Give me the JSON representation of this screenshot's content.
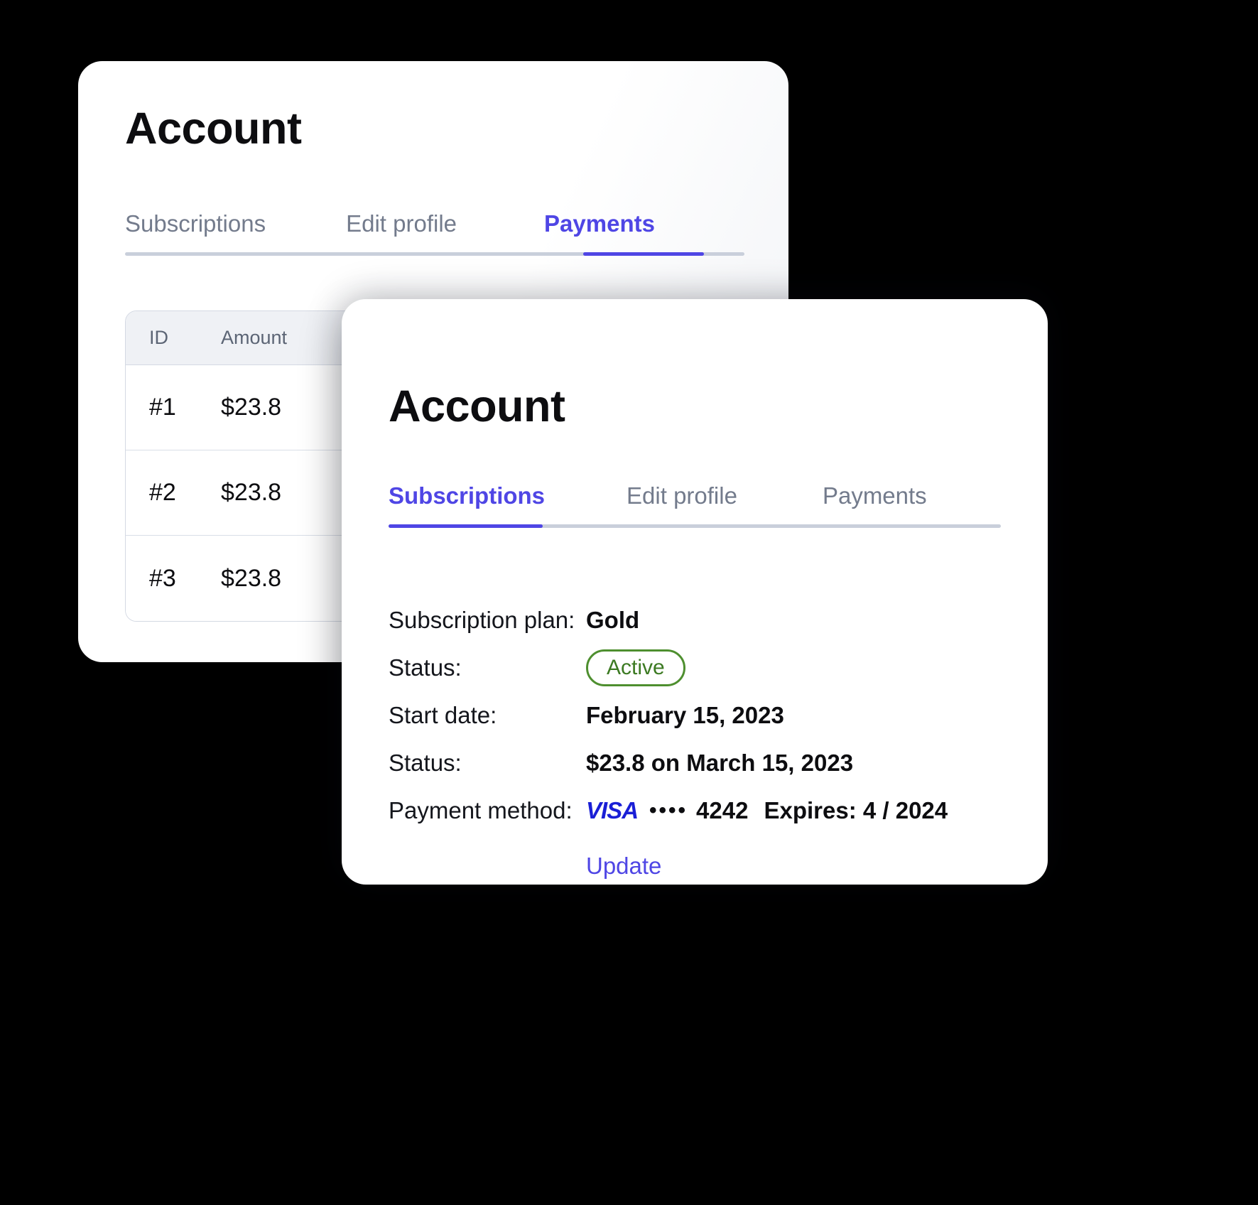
{
  "accent": "#4f46e5",
  "status_green": "#4e8f2f",
  "visa_blue": "#1a1fd6",
  "back_card": {
    "title": "Account",
    "tabs": [
      {
        "label": "Subscriptions",
        "active": false
      },
      {
        "label": "Edit profile",
        "active": false
      },
      {
        "label": "Payments",
        "active": true
      }
    ],
    "table": {
      "columns": [
        "ID",
        "Amount",
        ""
      ],
      "rows": [
        {
          "id": "#1",
          "amount": "$23.8",
          "date": ""
        },
        {
          "id": "#2",
          "amount": "$23.8",
          "date": ""
        },
        {
          "id": "#3",
          "amount": "$23.8",
          "date": ""
        }
      ]
    }
  },
  "front_card": {
    "title": "Account",
    "tabs": [
      {
        "label": "Subscriptions",
        "active": true
      },
      {
        "label": "Edit profile",
        "active": false
      },
      {
        "label": "Payments",
        "active": false
      }
    ],
    "details": {
      "plan_label": "Subscription plan:",
      "plan_value": "Gold",
      "status_label": "Status:",
      "status_value": "Active",
      "start_label": "Start date:",
      "start_value": "February 15, 2023",
      "next_label": "Status:",
      "next_value": "$23.8 on March 15, 2023",
      "payment_label": "Payment method:",
      "card_brand": "VISA",
      "card_dots": "••••",
      "card_last4": "4242",
      "card_expires": "Expires: 4 / 2024",
      "update_link": "Update"
    }
  }
}
